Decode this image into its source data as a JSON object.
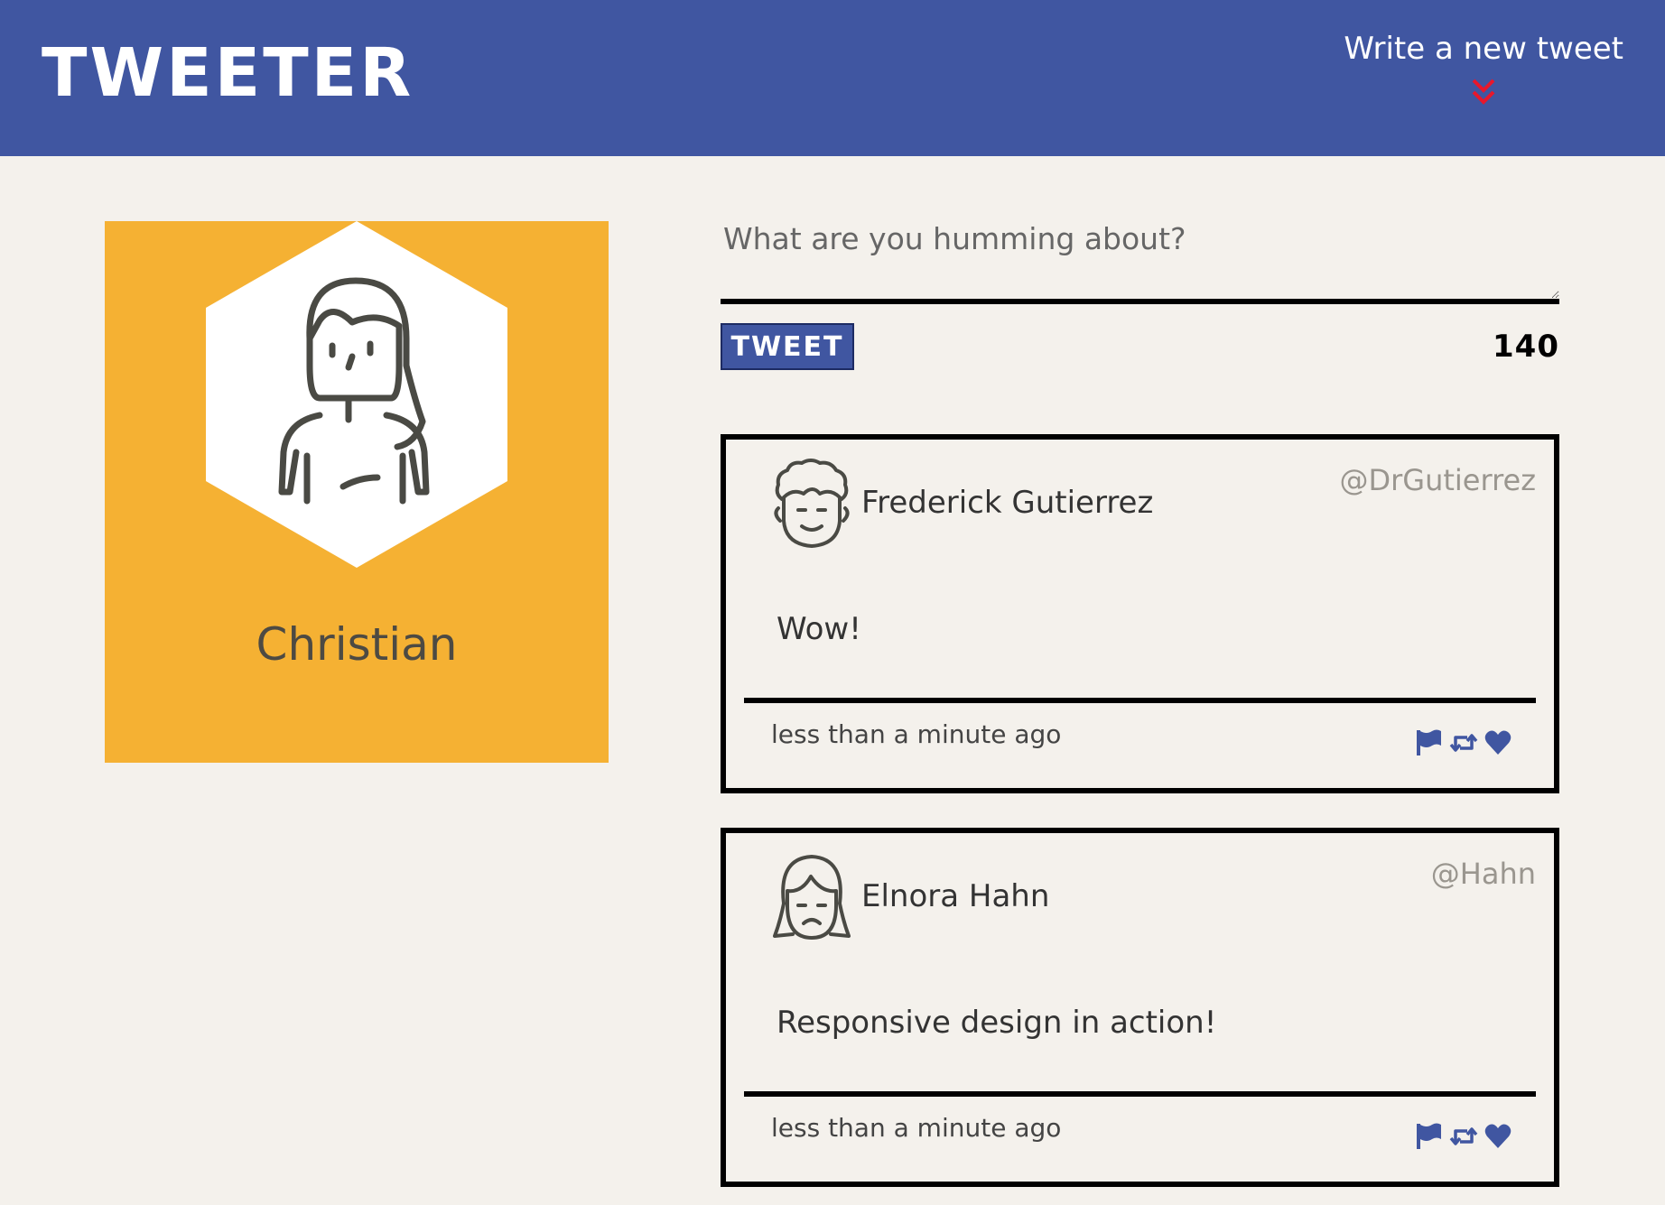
{
  "header": {
    "brand": "TWEETER",
    "compose_label": "Write a new tweet",
    "compose_icon": "double-chevron-down-icon",
    "background": "#4056a1",
    "accent": "#e8172c"
  },
  "profile": {
    "name": "Christian",
    "background": "#f5b133",
    "avatar_icon": "female-user-avatar-icon"
  },
  "composer": {
    "placeholder": "What are you humming about?",
    "button_label": "TWEET",
    "counter": "140"
  },
  "tweets": [
    {
      "name": "Frederick Gutierrez",
      "handle": "@DrGutierrez",
      "body": "Wow!",
      "time": "less than a minute ago",
      "avatar_icon": "curly-hair-man-avatar-icon",
      "actions": [
        "flag-icon",
        "retweet-icon",
        "heart-icon"
      ]
    },
    {
      "name": "Elnora Hahn",
      "handle": "@Hahn",
      "body": "Responsive design in action!",
      "time": "less than a minute ago",
      "avatar_icon": "sad-woman-avatar-icon",
      "actions": [
        "flag-icon",
        "retweet-icon",
        "heart-icon"
      ]
    }
  ]
}
